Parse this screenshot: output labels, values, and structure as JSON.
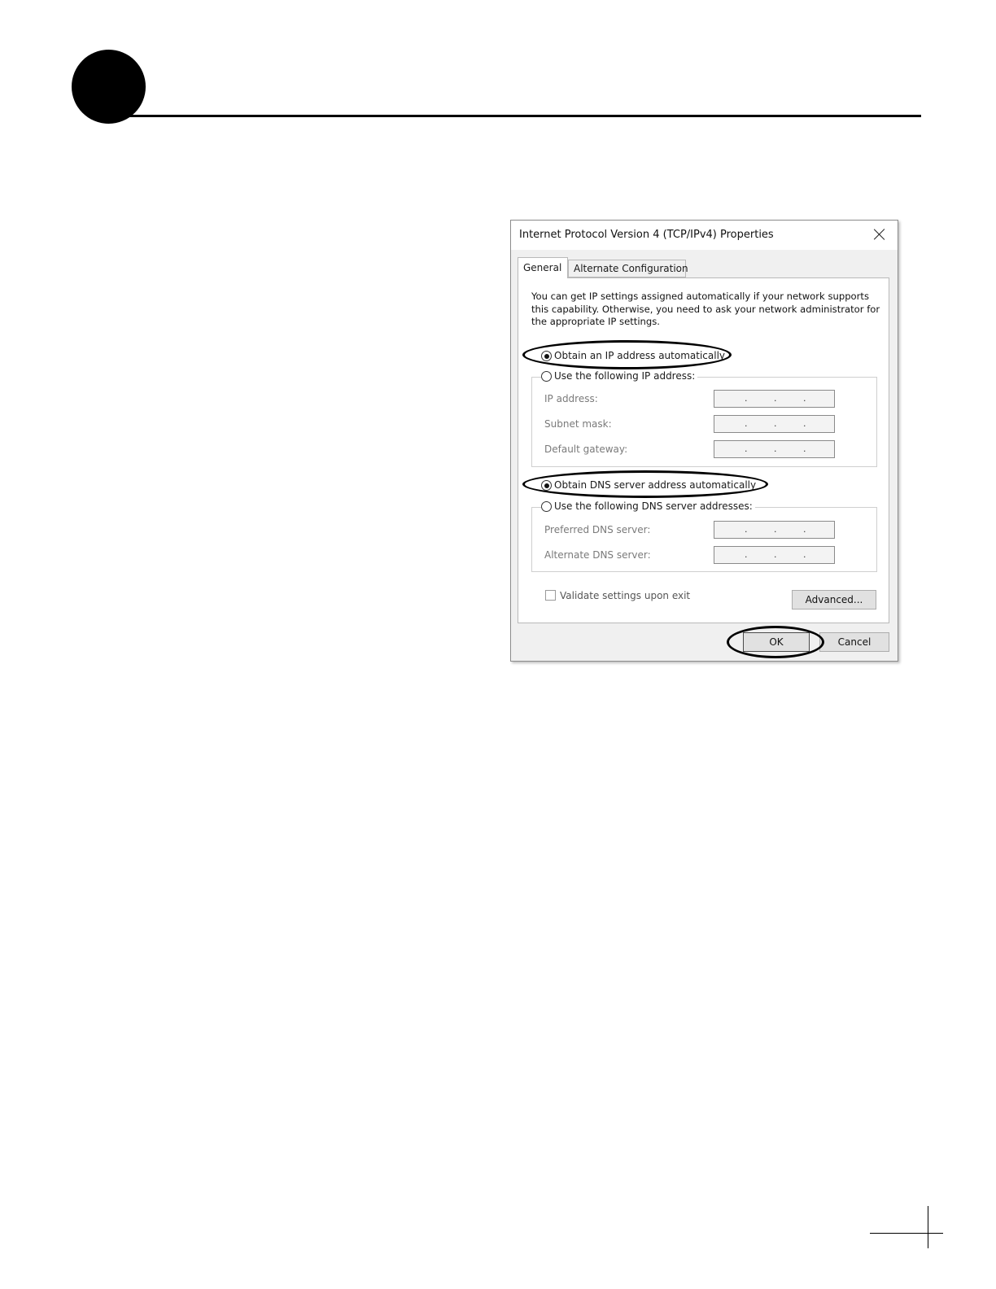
{
  "dialog": {
    "title": "Internet Protocol Version 4 (TCP/IPv4) Properties",
    "tabs": [
      {
        "label": "General",
        "active": true
      },
      {
        "label": "Alternate Configuration",
        "active": false
      }
    ],
    "description": "You can get IP settings assigned automatically if your network supports this capability. Otherwise, you need to ask your network administrator for the appropriate IP settings.",
    "ip_section": {
      "auto_label": "Obtain an IP address automatically",
      "auto_selected": true,
      "manual_label": "Use the following IP address:",
      "fields": [
        {
          "label": "IP address:",
          "value": ""
        },
        {
          "label": "Subnet mask:",
          "value": ""
        },
        {
          "label": "Default gateway:",
          "value": ""
        }
      ]
    },
    "dns_section": {
      "auto_label": "Obtain DNS server address automatically",
      "auto_selected": true,
      "manual_label": "Use the following DNS server addresses:",
      "fields": [
        {
          "label": "Preferred DNS server:",
          "value": ""
        },
        {
          "label": "Alternate DNS server:",
          "value": ""
        }
      ]
    },
    "validate_label": "Validate settings upon exit",
    "validate_checked": false,
    "advanced_label": "Advanced...",
    "ok_label": "OK",
    "cancel_label": "Cancel",
    "close_icon": "close-icon"
  },
  "page": {
    "bullet_icon": "circle-bullet-icon"
  }
}
